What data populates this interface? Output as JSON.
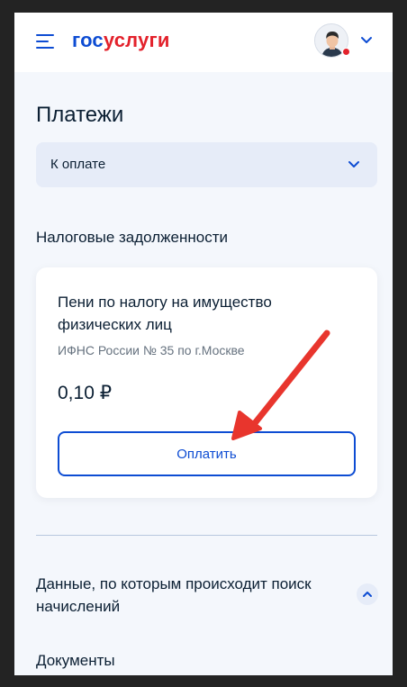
{
  "header": {
    "logo_part1": "гос",
    "logo_part2": "услуги",
    "menu_icon": "hamburger-menu-icon",
    "avatar_icon": "user-avatar",
    "notification_color": "#e3222c"
  },
  "page": {
    "title": "Платежи"
  },
  "filter": {
    "selected": "К оплате"
  },
  "debts": {
    "section_title": "Налоговые задолженности",
    "card": {
      "title": "Пени по налогу на имущество физических лиц",
      "organization": "ИФНС России № 35 по г.Москве",
      "amount": "0,10 ₽",
      "pay_label": "Оплатить"
    }
  },
  "info": {
    "accordion_title": "Данные, по которым происходит поиск начислений",
    "documents_title": "Документы"
  },
  "colors": {
    "brand_blue": "#0d4cd3",
    "brand_red": "#e3222c",
    "background": "#f4f7fc",
    "annotation_arrow": "#e8352d"
  }
}
